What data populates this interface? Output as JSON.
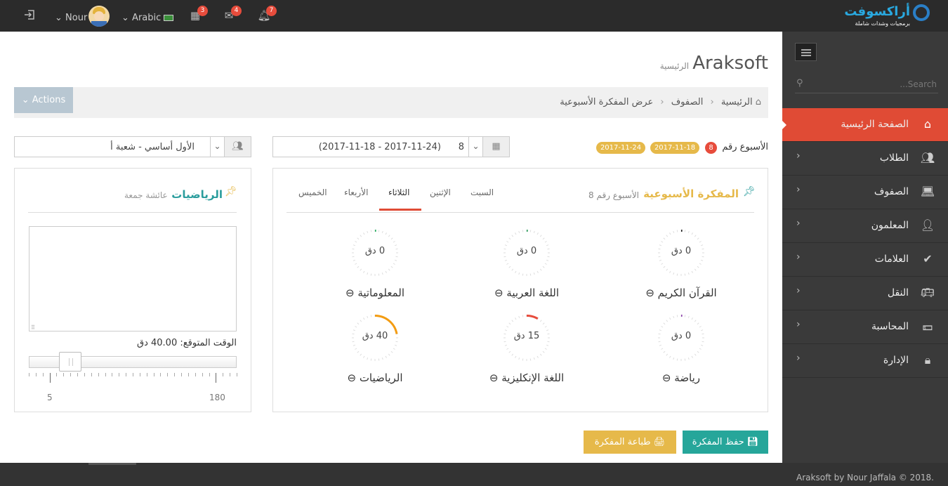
{
  "topbar": {
    "brand": "أراكسوفت",
    "brand_sub": "برمجيات وشدات شاملة",
    "user": "Nour",
    "language": "Arabic",
    "calendar_count": "3",
    "mail_count": "4",
    "bell_count": "7"
  },
  "sidebar": {
    "search_placeholder": "...Search",
    "items": [
      {
        "label": "الصفحة الرئيسية",
        "icon": "home-icon"
      },
      {
        "label": "الطلاب",
        "icon": "users-icon"
      },
      {
        "label": "الصفوف",
        "icon": "laptop-icon"
      },
      {
        "label": "المعلمون",
        "icon": "user-icon"
      },
      {
        "label": "العلامات",
        "icon": "check-circle-icon"
      },
      {
        "label": "النقل",
        "icon": "bus-icon"
      },
      {
        "label": "المحاسبة",
        "icon": "money-icon"
      },
      {
        "label": "الإدارة",
        "icon": "lock-icon"
      }
    ]
  },
  "page": {
    "title": "Araksoft",
    "subtitle": "الرئيسية",
    "actions_label": "Actions",
    "breadcrumb": [
      "الرئيسية",
      "الصفوف",
      "عرض المفكرة الأسبوعية"
    ]
  },
  "week": {
    "label": "الأسبوع رقم",
    "number": "8",
    "start": "2017-11-18",
    "end": "2017-11-24",
    "select_value": "(2017-11-18 - 2017-11-24)      8"
  },
  "class_select": "الأول أساسي - شعبة أ",
  "notebook": {
    "title": "المفكرة الأسبوعية",
    "subtitle": "الأسبوع رقم 8",
    "tabs": [
      "السبت",
      "الإثنين",
      "الثلاثاء",
      "الأربعاء",
      "الخميس"
    ],
    "active_tab": 2,
    "subjects": [
      {
        "name": "القرآن الكريم",
        "value": "0 دق",
        "color": "#222"
      },
      {
        "name": "اللغة العربية",
        "value": "0 دق",
        "color": "#2a9d5c"
      },
      {
        "name": "المعلوماتية",
        "value": "0 دق",
        "color": "#27ae60"
      },
      {
        "name": "رياضة",
        "value": "0 دق",
        "color": "#8e44ad"
      },
      {
        "name": "اللغة الإنكليزية",
        "value": "15 دق",
        "color": "#e74c3c"
      },
      {
        "name": "الرياضيات",
        "value": "40 دق",
        "color": "#f39c12"
      }
    ]
  },
  "subject_panel": {
    "title": "الرياضيات",
    "teacher": "عائشة جمعة",
    "expected_label": "الوقت المتوقع: 40.00 دق",
    "slider_value": 40,
    "slider_min_label": "5",
    "slider_max_label": "180"
  },
  "buttons": {
    "save": "حفظ المفكرة",
    "print": "طباعة المفكرة"
  },
  "footer": "Araksoft by Nour Jaffala © 2018."
}
